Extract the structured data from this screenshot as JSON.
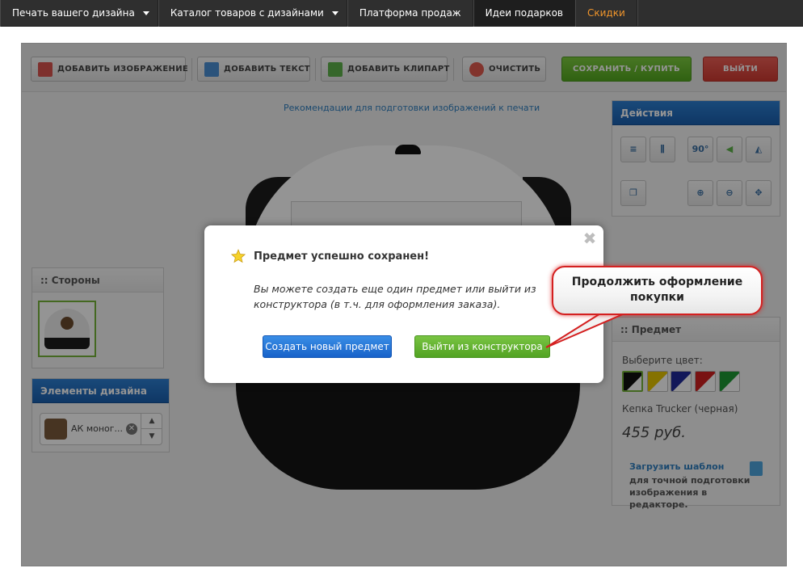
{
  "nav": {
    "items": [
      {
        "label": "Печать вашего дизайна",
        "dropdown": true
      },
      {
        "label": "Каталог товаров с дизайнами",
        "dropdown": true
      },
      {
        "label": "Платформа продаж",
        "dropdown": false
      },
      {
        "label": "Идеи подарков",
        "dropdown": false
      },
      {
        "label": "Скидки",
        "dropdown": false
      }
    ]
  },
  "toolbar": {
    "add_image": "ДОБАВИТЬ ИЗОБРАЖЕНИЕ",
    "add_text": "ДОБАВИТЬ ТЕКСТ",
    "add_clipart": "ДОБАВИТЬ КЛИПАРТ",
    "clear": "ОЧИСТИТЬ",
    "save_buy": "СОХРАНИТЬ / КУПИТЬ",
    "exit": "ВЫЙТИ"
  },
  "guideline_link": "Рекомендации для подготовки изображений к печати",
  "sides_panel": {
    "title": ":: Стороны"
  },
  "design_elements": {
    "title": "Элементы дизайна",
    "item_label": "АК моног...",
    "up": "▲",
    "down": "▼"
  },
  "actions_panel": {
    "title": "Действия",
    "rotate_label": "90°"
  },
  "subject_panel": {
    "title": ":: Предмет",
    "choose_color": "Выберите цвет:",
    "product_name": "Кепка Trucker (черная)",
    "price": "455 руб.",
    "template_link": "Загрузить шаблон",
    "template_desc": "для точной подготовки изображения в редакторе."
  },
  "swatch_colors": [
    "#111111",
    "#e5c400",
    "#1f2a99",
    "#d11f1f",
    "#1e9a35"
  ],
  "modal": {
    "close": "✖",
    "title": "Предмет успешно сохранен!",
    "text": "Вы можете создать еще один предмет или выйти из конструктора (в т.ч. для оформления заказа).",
    "create_new": "Создать новый предмет",
    "exit_builder": "Выйти из конструктора"
  },
  "callout": {
    "text": "Продолжить оформление покупки"
  }
}
